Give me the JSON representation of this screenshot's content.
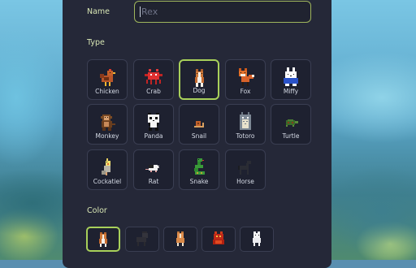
{
  "form": {
    "name_label": "Name",
    "name_placeholder": "Rex",
    "type_label": "Type",
    "color_label": "Color"
  },
  "types": [
    {
      "label": "Chicken",
      "icon": "chicken-icon",
      "selected": false
    },
    {
      "label": "Crab",
      "icon": "crab-icon",
      "selected": false
    },
    {
      "label": "Dog",
      "icon": "dog-icon",
      "selected": true
    },
    {
      "label": "Fox",
      "icon": "fox-icon",
      "selected": false
    },
    {
      "label": "Miffy",
      "icon": "miffy-icon",
      "selected": false
    },
    {
      "label": "Monkey",
      "icon": "monkey-icon",
      "selected": false
    },
    {
      "label": "Panda",
      "icon": "panda-icon",
      "selected": false
    },
    {
      "label": "Snail",
      "icon": "snail-icon",
      "selected": false
    },
    {
      "label": "Totoro",
      "icon": "totoro-icon",
      "selected": false
    },
    {
      "label": "Turtle",
      "icon": "turtle-icon",
      "selected": false
    },
    {
      "label": "Cockatiel",
      "icon": "cockatiel-icon",
      "selected": false
    },
    {
      "label": "Rat",
      "icon": "rat-icon",
      "selected": false
    },
    {
      "label": "Snake",
      "icon": "snake-icon",
      "selected": false
    },
    {
      "label": "Horse",
      "icon": "horse-icon",
      "selected": false
    }
  ],
  "colors": [
    {
      "icon": "dog-brown-icon",
      "selected": true
    },
    {
      "icon": "dog-black-icon",
      "selected": false
    },
    {
      "icon": "dog-tan-icon",
      "selected": false
    },
    {
      "icon": "dog-red-icon",
      "selected": false
    },
    {
      "icon": "dog-white-icon",
      "selected": false
    }
  ],
  "theme": {
    "panel": "#252838",
    "accent": "#a8d05a",
    "label": "#d8e6b4"
  }
}
